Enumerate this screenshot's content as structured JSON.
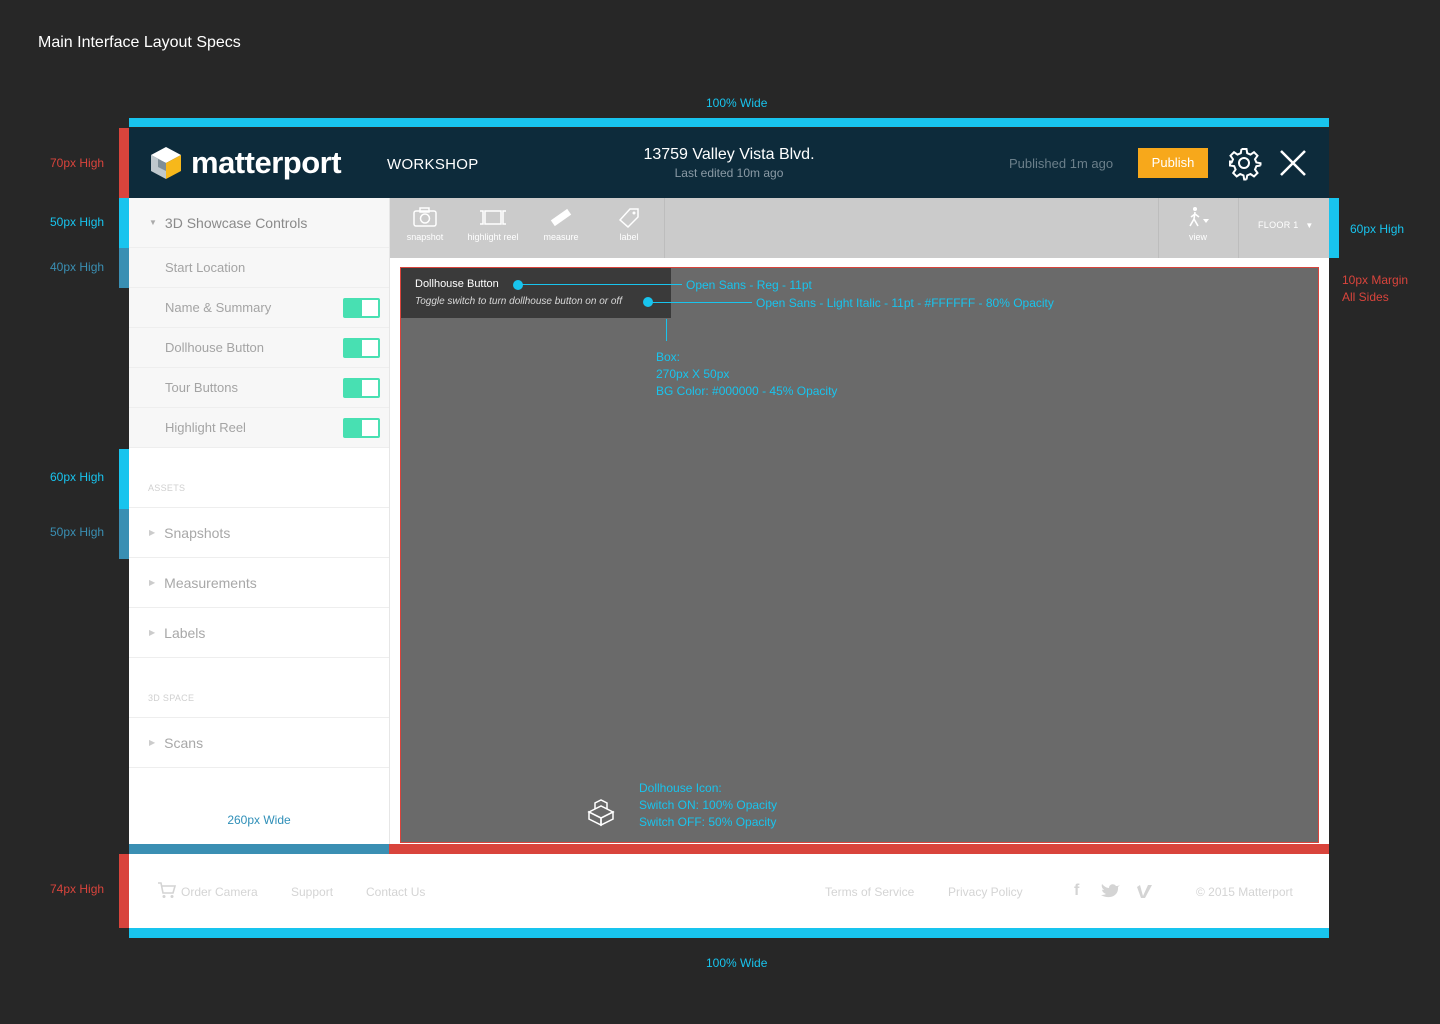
{
  "spec": {
    "title": "Main Interface Layout Specs",
    "top_width": "100% Wide",
    "bottom_width": "100% Wide",
    "header_height": "70px High",
    "section_height_1": "50px High",
    "row_height": "40px High",
    "section_height_2": "60px High",
    "item_height": "50px High",
    "toolbar_height": "60px High",
    "margin_1": "10px Margin",
    "margin_2": "All Sides",
    "footer_height": "74px High",
    "font_reg": "Open Sans - Reg - 11pt",
    "font_italic": "Open Sans - Light Italic - 11pt - #FFFFFF - 80% Opacity",
    "box_1": "Box:",
    "box_2": "270px X 50px",
    "box_3": "BG Color: #000000 - 45% Opacity",
    "icon_1": "Dollhouse Icon:",
    "icon_2": "Switch ON: 100% Opacity",
    "icon_3": "Switch OFF: 50% Opacity",
    "sidebar_width": "260px Wide"
  },
  "header": {
    "brand": "matterport",
    "section": "WORKSHOP",
    "address": "13759 Valley Vista Blvd.",
    "last_edited": "Last edited 10m ago",
    "published": "Published 1m ago",
    "publish_label": "Publish"
  },
  "sidebar": {
    "section_title": "3D Showcase Controls",
    "rows": [
      {
        "label": "Start Location"
      },
      {
        "label": "Name & Summary",
        "toggle": true
      },
      {
        "label": "Dollhouse Button",
        "toggle": true
      },
      {
        "label": "Tour Buttons",
        "toggle": true
      },
      {
        "label": "Highlight Reel",
        "toggle": true
      }
    ],
    "assets_label": "ASSETS",
    "assets": [
      "Snapshots",
      "Measurements",
      "Labels"
    ],
    "space_label": "3D SPACE",
    "space_items": [
      "Scans"
    ]
  },
  "toolbar": {
    "tools": [
      "snapshot",
      "highlight reel",
      "measure",
      "label"
    ],
    "view_label": "view",
    "floor_label": "FLOOR 1"
  },
  "viewport": {
    "dollhouse_title": "Dollhouse Button",
    "dollhouse_desc": "Toggle switch to turn dollhouse button on or off"
  },
  "footer": {
    "order_camera": "Order Camera",
    "support": "Support",
    "contact": "Contact Us",
    "terms": "Terms of Service",
    "privacy": "Privacy Policy",
    "copyright": "© 2015 Matterport"
  },
  "colors": {
    "header_bg": "#0d2b3b",
    "accent_cyan": "#18c4ee",
    "spec_red": "#d9443c",
    "publish": "#f7a81b",
    "toggle_on": "#48e0b2"
  }
}
